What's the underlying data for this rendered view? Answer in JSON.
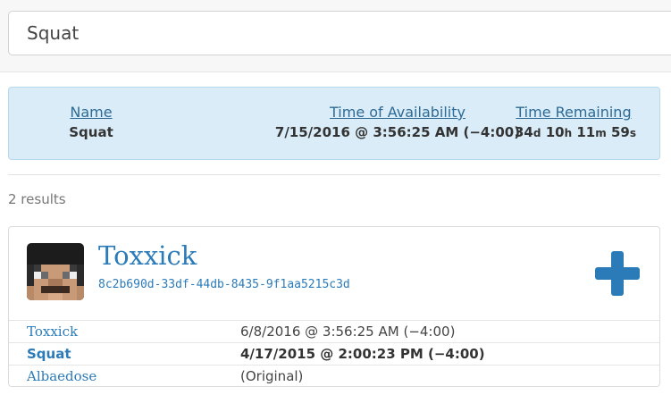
{
  "search": {
    "value": "Squat"
  },
  "info": {
    "name_header": "Name",
    "name_value": "Squat",
    "availability_header": "Time of Availability",
    "availability_value": "7/15/2016 @ 3:56:25 AM (−4:00)",
    "remaining_header": "Time Remaining",
    "remaining": {
      "days": "34",
      "days_unit": "d",
      "hours": "10",
      "hours_unit": "h",
      "minutes": "11",
      "minutes_unit": "m",
      "seconds": "59",
      "seconds_unit": "s"
    }
  },
  "results": {
    "count_label": "2 results"
  },
  "profile": {
    "name": "Toxxick",
    "uuid": "8c2b690d-33df-44db-8435-9f1aa5215c3d",
    "avatar_icon": "minecraft-skin-face-icon",
    "add_icon": "plus-icon",
    "accent_color": "#2b7bb9",
    "history": [
      {
        "name": "Toxxick",
        "date": "6/8/2016 @ 3:56:25 AM (−4:00)"
      },
      {
        "name": "Squat",
        "date": "4/17/2015 @ 2:00:23 PM (−4:00)"
      },
      {
        "name": "Albaedose",
        "date": "(Original)"
      }
    ]
  }
}
